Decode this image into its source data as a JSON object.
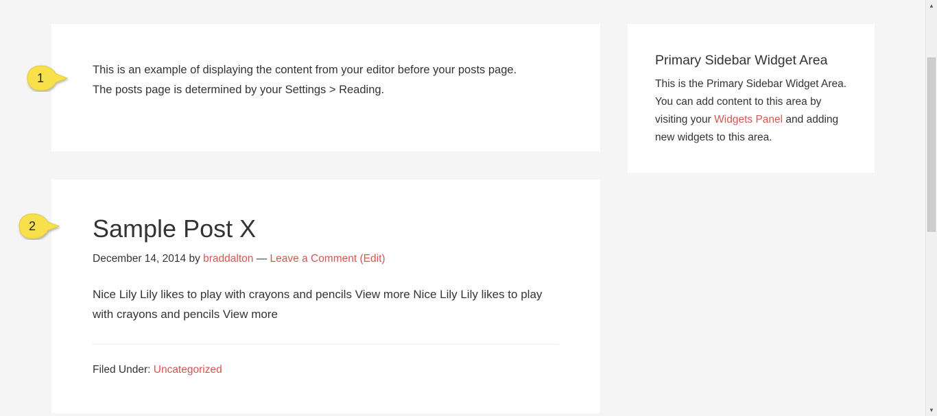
{
  "intro": {
    "line1": "This is an example of displaying the content from your editor before your posts page.",
    "line2": "The posts page is determined by your Settings > Reading."
  },
  "post": {
    "title": "Sample Post X",
    "date": "December 14, 2014",
    "by": "by",
    "author": "braddalton",
    "dash": "—",
    "comment_link": "Leave a Comment",
    "edit_link": "(Edit)",
    "body": "Nice Lily Lily likes to play with crayons and pencils View more Nice Lily Lily likes to play with crayons and pencils View more",
    "filed_under_label": "Filed Under:",
    "category": "Uncategorized"
  },
  "sidebar": {
    "widget_title": "Primary Sidebar Widget Area",
    "text_before": "This is the Primary Sidebar Widget Area. You can add content to this area by visiting your",
    "link": "Widgets Panel",
    "text_after": "and adding new widgets to this area."
  },
  "callouts": [
    {
      "label": "1"
    },
    {
      "label": "2"
    }
  ],
  "colors": {
    "link": "#d9534f",
    "callout": "#f7e04b",
    "background": "#f5f5f5"
  },
  "icons": {
    "scroll_up": "triangle-up-icon",
    "scroll_down": "triangle-down-icon"
  }
}
